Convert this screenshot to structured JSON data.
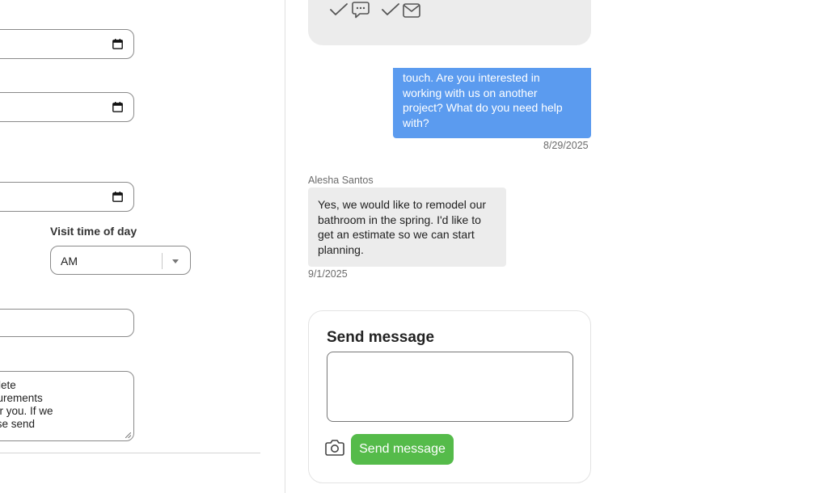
{
  "form": {
    "visit_time_label": "Visit time of day",
    "visit_time_value": "AM",
    "notes_lines": [
      "e for a complete",
      "d take measurements",
      "that works for you. If we",
      "d times please send"
    ]
  },
  "chat": {
    "outgoing_message": {
      "lines": [
        "touch. Are you interested in",
        "working with us on another",
        "project? What do you need help",
        "with?"
      ],
      "timestamp": "8/29/2025"
    },
    "incoming_message": {
      "sender": "Alesha Santos",
      "lines": [
        "Yes, we would like to remodel our",
        "bathroom in the spring. I'd like to",
        "get an estimate so we can start",
        "planning."
      ],
      "timestamp": "9/1/2025"
    },
    "compose": {
      "title": "Send message",
      "input_value": "",
      "send_label": "Send message"
    }
  },
  "icons": {
    "calendar": "calendar-icon",
    "caret": "chevron-down-icon",
    "check": "check-icon",
    "chat_bubble": "chat-bubble-icon",
    "envelope": "envelope-icon",
    "camera": "camera-icon"
  },
  "colors": {
    "outgoing_bubble": "#5b9bef",
    "incoming_bubble": "#ececec",
    "send_button": "#55bb4a"
  }
}
